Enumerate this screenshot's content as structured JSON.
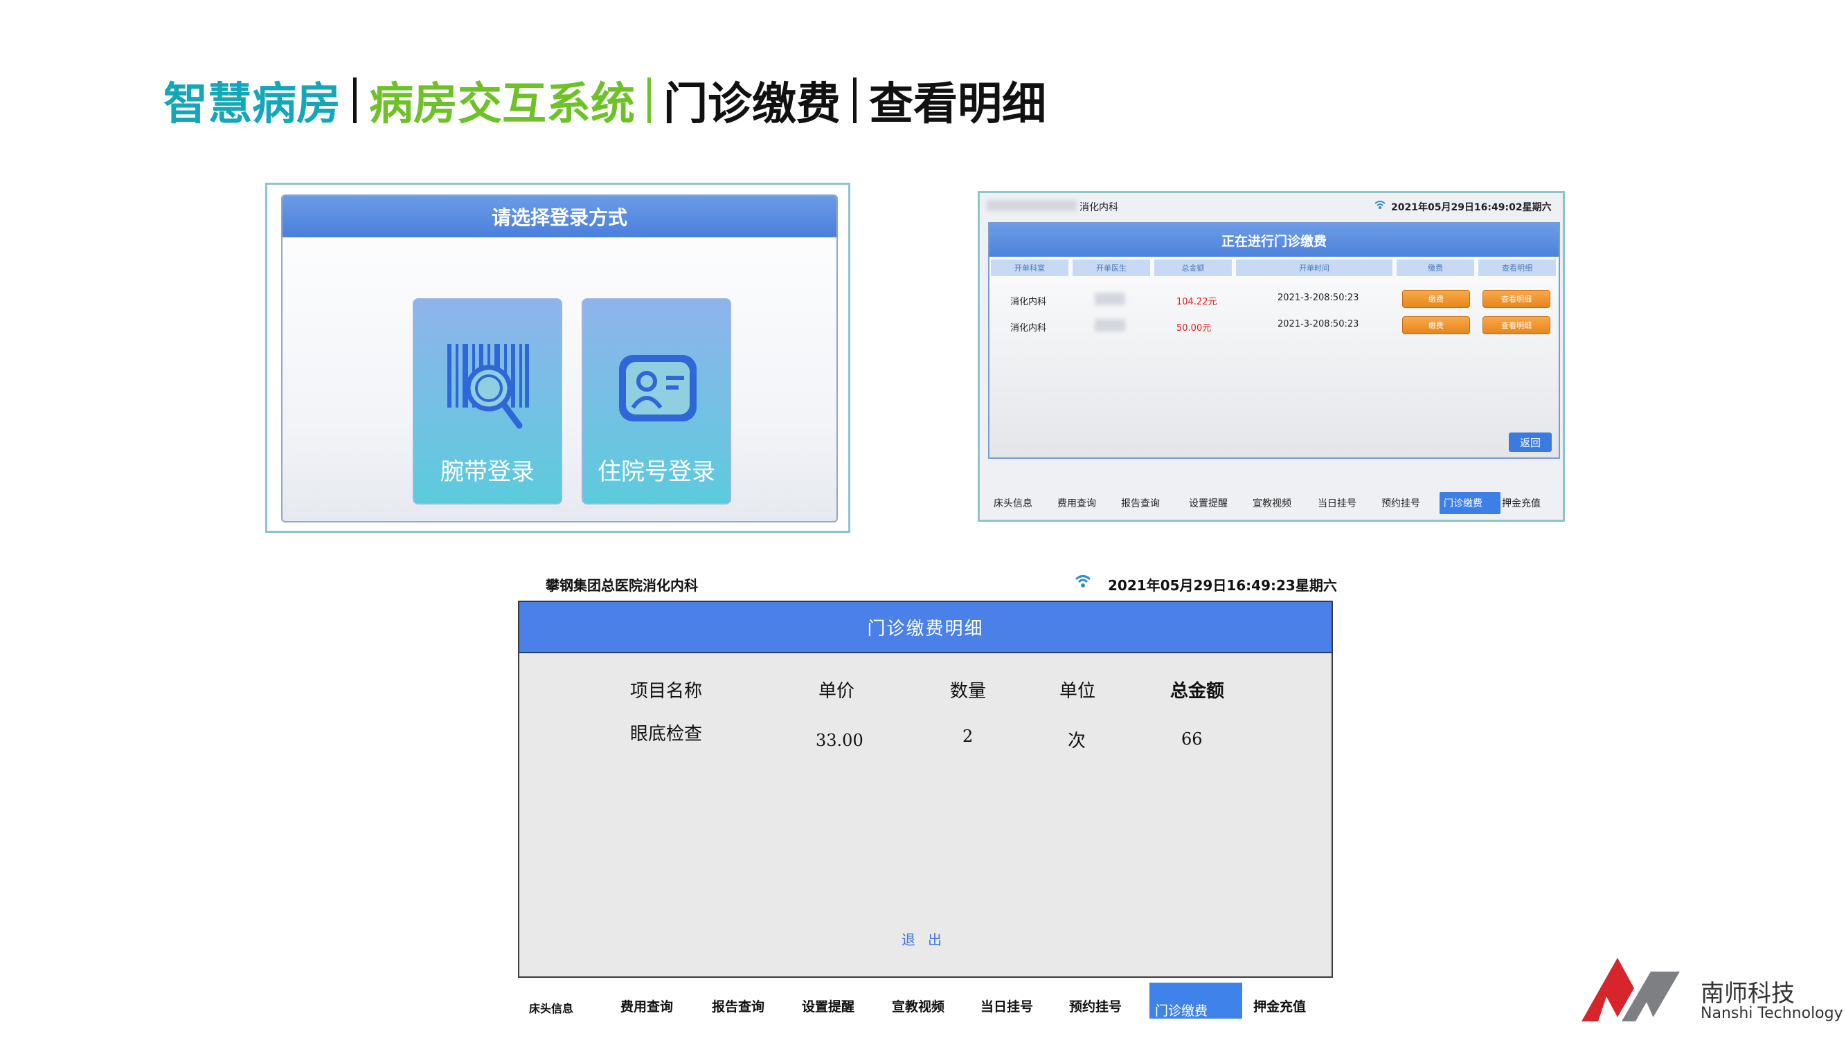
{
  "slide": {
    "title_parts": [
      "智慧病房",
      "病房交互系统",
      "门诊缴费",
      "查看明细"
    ],
    "title_colors": [
      "#13a7b8",
      "#6ec127",
      "#111111",
      "#111111"
    ]
  },
  "login_panel": {
    "header": "请选择登录方式",
    "buttons": [
      {
        "label": "腕带登录",
        "icon": "barcode-search-icon"
      },
      {
        "label": "住院号登录",
        "icon": "id-card-icon"
      }
    ]
  },
  "outpatient_panel": {
    "department": "消化内科",
    "datetime": "2021年05月29日16:49:02星期六",
    "header": "正在进行门诊缴费",
    "columns": [
      "开单科室",
      "开单医生",
      "总金额",
      "开单时间",
      "缴费",
      "查看明细"
    ],
    "rows": [
      {
        "department": "消化内科",
        "amount": "104.22元",
        "time": "2021-3-208:50:23"
      },
      {
        "department": "消化内科",
        "amount": "50.00元",
        "time": "2021-3-208:50:23"
      }
    ],
    "row_buttons": {
      "pay": "缴费",
      "detail": "查看明细"
    },
    "return_button": "返回",
    "nav": [
      "床头信息",
      "费用查询",
      "报告查询",
      "设置提醒",
      "宣教视频",
      "当日挂号",
      "预约挂号",
      "门诊缴费",
      "押金充值"
    ]
  },
  "detail_panel": {
    "hospital": "攀钢集团总医院消化内科",
    "datetime": "2021年05月29日16:49:23星期六",
    "header": "门诊缴费明细",
    "columns": [
      "项目名称",
      "单价",
      "数量",
      "单位",
      "总金额"
    ],
    "rows": [
      {
        "item": "眼底检查",
        "unit_price": "33.00",
        "quantity": "2",
        "unit": "次",
        "total": "66"
      }
    ],
    "exit_button": "退出",
    "nav": [
      "床头信息",
      "费用查询",
      "报告查询",
      "设置提醒",
      "宣教视频",
      "当日挂号",
      "预约挂号",
      "门诊缴费",
      "押金充值"
    ],
    "active_nav": "门诊缴费"
  },
  "company": {
    "name_cn": "南师科技",
    "name_en": "Nanshi Technology",
    "brand_colors": [
      "#d7262b",
      "#7d7f83"
    ]
  }
}
